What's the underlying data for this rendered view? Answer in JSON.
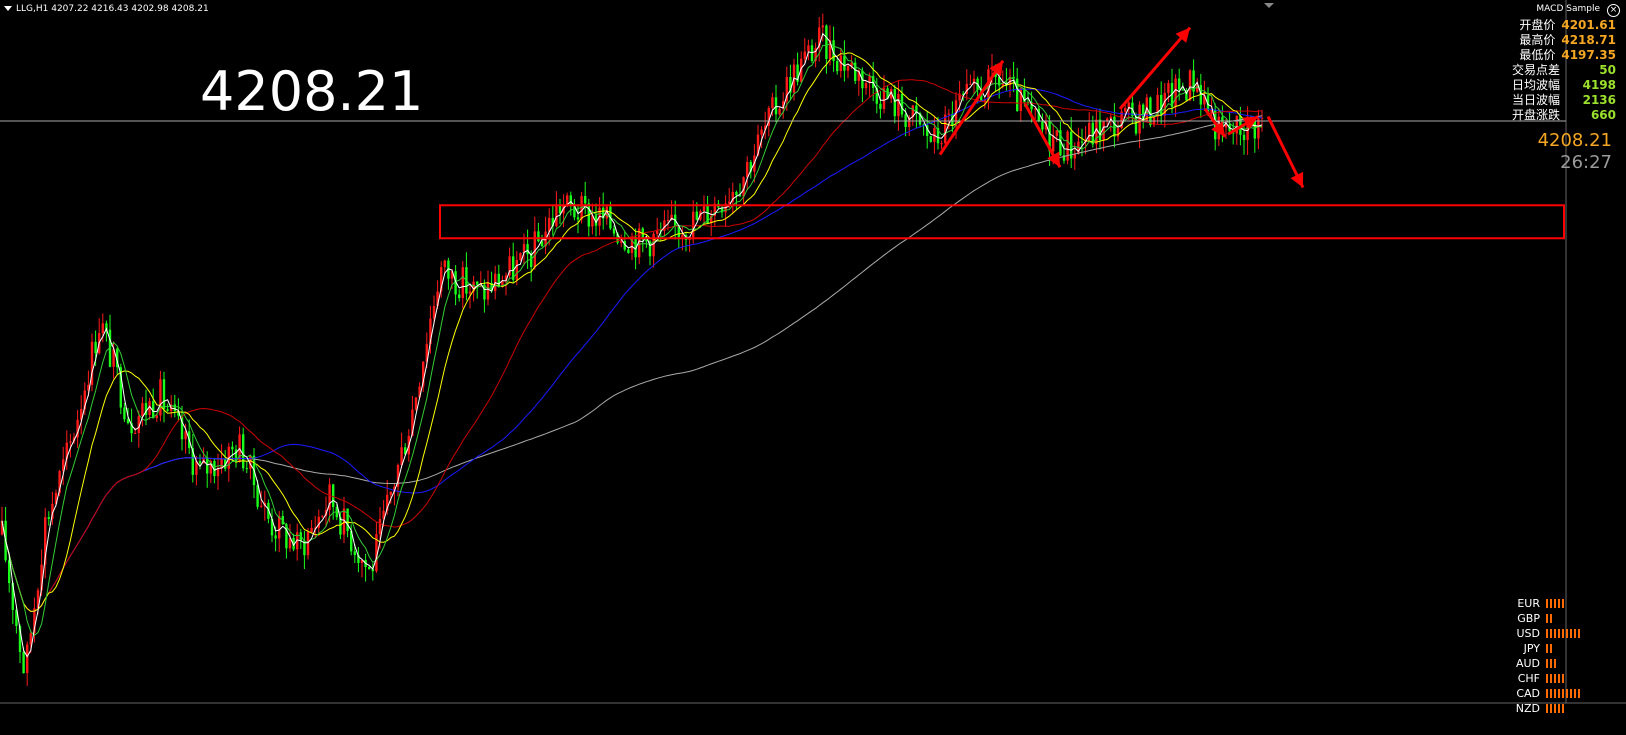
{
  "header": {
    "symbol_line": "LLG,H1  4207.22 4216.43 4202.98 4208.21",
    "big_price": "4208.21",
    "indicator_name": "MACD Sample"
  },
  "info_panel": [
    {
      "label": "开盘价",
      "value": "4201.61",
      "color": "#f5a623"
    },
    {
      "label": "最高价",
      "value": "4218.71",
      "color": "#f5a623"
    },
    {
      "label": "最低价",
      "value": "4197.35",
      "color": "#f5a623"
    },
    {
      "label": "交易点差",
      "value": "50",
      "color": "#9be12c"
    },
    {
      "label": "日均波幅",
      "value": "4198",
      "color": "#9be12c"
    },
    {
      "label": "当日波幅",
      "value": "2136",
      "color": "#9be12c"
    },
    {
      "label": "开盘涨跌",
      "value": "660",
      "color": "#9be12c"
    }
  ],
  "price_display": "4208.21",
  "timer": "26:27",
  "currency_strength": [
    {
      "code": "EUR",
      "bars": 5
    },
    {
      "code": "GBP",
      "bars": 2
    },
    {
      "code": "USD",
      "bars": 9
    },
    {
      "code": "JPY",
      "bars": 2
    },
    {
      "code": "AUD",
      "bars": 3
    },
    {
      "code": "CHF",
      "bars": 5
    },
    {
      "code": "CAD",
      "bars": 9
    },
    {
      "code": "NZD",
      "bars": 5
    }
  ],
  "colors": {
    "up_candle": "#ff1a1a",
    "down_candle": "#1aff1a",
    "ma_fast": "#ffffff",
    "ma_mid": "#33cc33",
    "ma_slow": "#ffff00",
    "ma_red": "#cc0000",
    "ma_blue": "#1a1aff",
    "ma_gray": "#aaaaaa",
    "annotation": "#ff0000"
  },
  "chart_data": {
    "type": "candlestick",
    "timeframe": "H1",
    "ylim": [
      3980,
      4250
    ],
    "current_price": 4208.21,
    "waypoints": [
      [
        0,
        4050
      ],
      [
        25,
        3990
      ],
      [
        45,
        4050
      ],
      [
        70,
        4080
      ],
      [
        100,
        4130
      ],
      [
        130,
        4090
      ],
      [
        160,
        4100
      ],
      [
        200,
        4070
      ],
      [
        240,
        4080
      ],
      [
        270,
        4050
      ],
      [
        300,
        4040
      ],
      [
        330,
        4060
      ],
      [
        370,
        4030
      ],
      [
        410,
        4090
      ],
      [
        440,
        4150
      ],
      [
        480,
        4140
      ],
      [
        530,
        4155
      ],
      [
        560,
        4175
      ],
      [
        600,
        4170
      ],
      [
        640,
        4160
      ],
      [
        700,
        4170
      ],
      [
        740,
        4185
      ],
      [
        790,
        4225
      ],
      [
        820,
        4240
      ],
      [
        850,
        4230
      ],
      [
        880,
        4220
      ],
      [
        910,
        4210
      ],
      [
        935,
        4200
      ],
      [
        960,
        4215
      ],
      [
        1000,
        4225
      ],
      [
        1040,
        4205
      ],
      [
        1070,
        4198
      ],
      [
        1100,
        4205
      ],
      [
        1150,
        4212
      ],
      [
        1195,
        4225
      ],
      [
        1220,
        4203
      ],
      [
        1260,
        4208
      ]
    ],
    "support_zone": {
      "top": 4175,
      "bottom": 4162,
      "x_start": 440
    },
    "annotations": [
      {
        "type": "arrow",
        "from": [
          940,
          4195
        ],
        "to": [
          1003,
          4232
        ]
      },
      {
        "type": "arrow",
        "from": [
          1025,
          4215
        ],
        "to": [
          1060,
          4190
        ]
      },
      {
        "type": "arrow",
        "from": [
          1120,
          4213
        ],
        "to": [
          1190,
          4245
        ]
      },
      {
        "type": "arrow",
        "from": [
          1205,
          4213
        ],
        "to": [
          1225,
          4202
        ]
      },
      {
        "type": "arrow",
        "from": [
          1228,
          4203
        ],
        "to": [
          1258,
          4210
        ]
      },
      {
        "type": "arrow",
        "from": [
          1268,
          4210
        ],
        "to": [
          1303,
          4182
        ]
      }
    ]
  }
}
